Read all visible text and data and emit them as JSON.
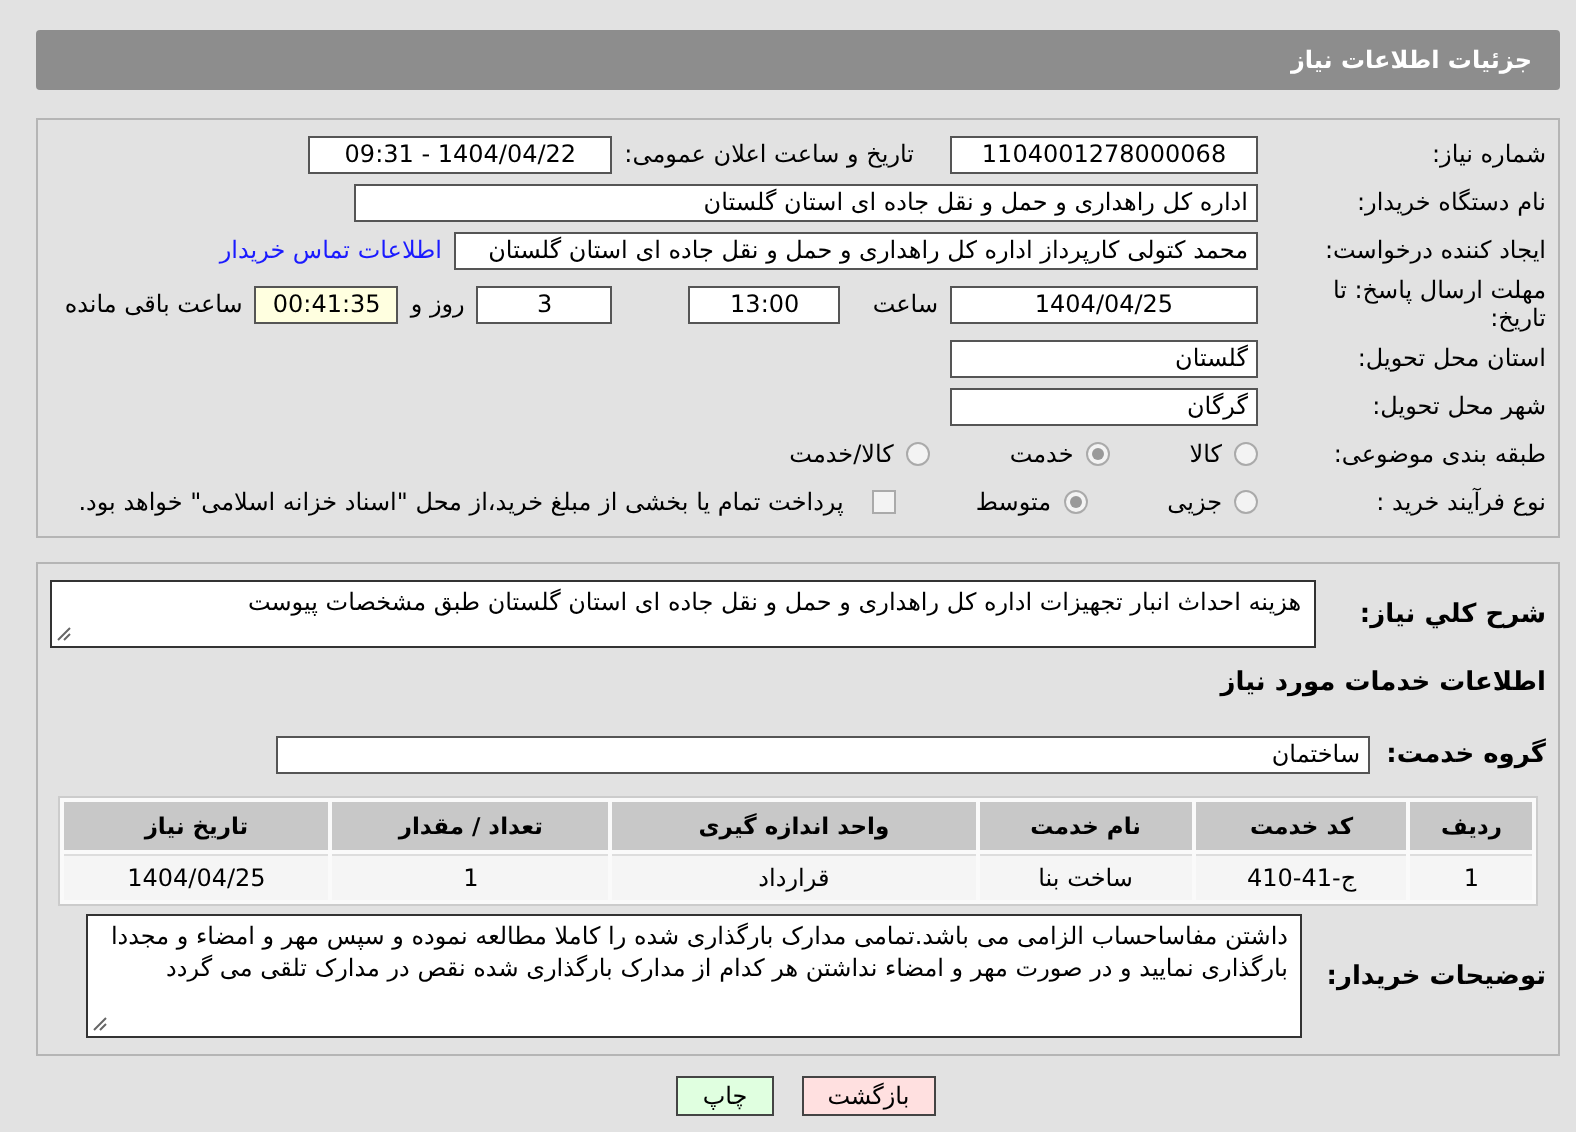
{
  "header": {
    "title": "جزئیات اطلاعات نیاز"
  },
  "need_number": {
    "label": "شماره نیاز:",
    "value": "1104001278000068"
  },
  "announce": {
    "label": "تاریخ و ساعت اعلان عمومی:",
    "value": "1404/04/22 - 09:31"
  },
  "buyer": {
    "label": "نام دستگاه خریدار:",
    "value": "اداره کل راهداری و حمل و نقل جاده ای استان گلستان"
  },
  "creator": {
    "label": "ایجاد کننده درخواست:",
    "value": "محمد کتولی کارپرداز اداره کل راهداری و حمل و نقل جاده ای استان گلستان",
    "link": "اطلاعات تماس خریدار"
  },
  "deadline": {
    "label": "مهلت ارسال پاسخ: تا تاریخ:",
    "date": "1404/04/25",
    "time_label": "ساعت",
    "time": "13:00",
    "days": "3",
    "days_label": "روز و",
    "remaining": "00:41:35",
    "remaining_label": "ساعت باقی مانده"
  },
  "province": {
    "label": "استان محل تحویل:",
    "value": "گلستان"
  },
  "city": {
    "label": "شهر محل تحویل:",
    "value": "گرگان"
  },
  "category": {
    "label": "طبقه بندی موضوعی:",
    "options": [
      {
        "label": "کالا",
        "selected": false
      },
      {
        "label": "خدمت",
        "selected": true
      },
      {
        "label": "کالا/خدمت",
        "selected": false
      }
    ]
  },
  "process": {
    "label": "نوع فرآیند خرید :",
    "options": [
      {
        "label": "جزیی",
        "selected": false
      },
      {
        "label": "متوسط",
        "selected": true
      }
    ],
    "payment": {
      "label": "پرداخت تمام یا بخشی از مبلغ خرید،از محل \"اسناد خزانه اسلامی\" خواهد بود.",
      "checked": false
    }
  },
  "summary": {
    "label": "شرح کلي نياز:",
    "value": "هزینه احداث انبار تجهیزات اداره کل راهداری و حمل و نقل جاده ای استان گلستان طبق مشخصات پیوست"
  },
  "services_heading": "اطلاعات خدمات مورد نیاز",
  "service_group": {
    "label": "گروه خدمت:",
    "value": "ساختمان"
  },
  "table": {
    "columns": [
      "ردیف",
      "کد خدمت",
      "نام خدمت",
      "واحد اندازه گیری",
      "تعداد / مقدار",
      "تاریخ نیاز"
    ],
    "rows": [
      [
        "1",
        "ج-41-410",
        "ساخت بنا",
        "قرارداد",
        "1",
        "1404/04/25"
      ]
    ]
  },
  "buyer_notes": {
    "label": "توضیحات خریدار:",
    "value": "داشتن مفاساحساب الزامی می باشد.تمامی مدارک بارگذاری شده را کاملا مطالعه نموده و سپس مهر و امضاء  و مجددا بارگذاری نمایید و در صورت مهر و امضاء نداشتن هر کدام از مدارک بارگذاری شده نقص در مدارک تلقی می گردد"
  },
  "buttons": [
    {
      "label": "بازگشت",
      "kind": "back"
    },
    {
      "label": "چاپ",
      "kind": "print"
    }
  ]
}
